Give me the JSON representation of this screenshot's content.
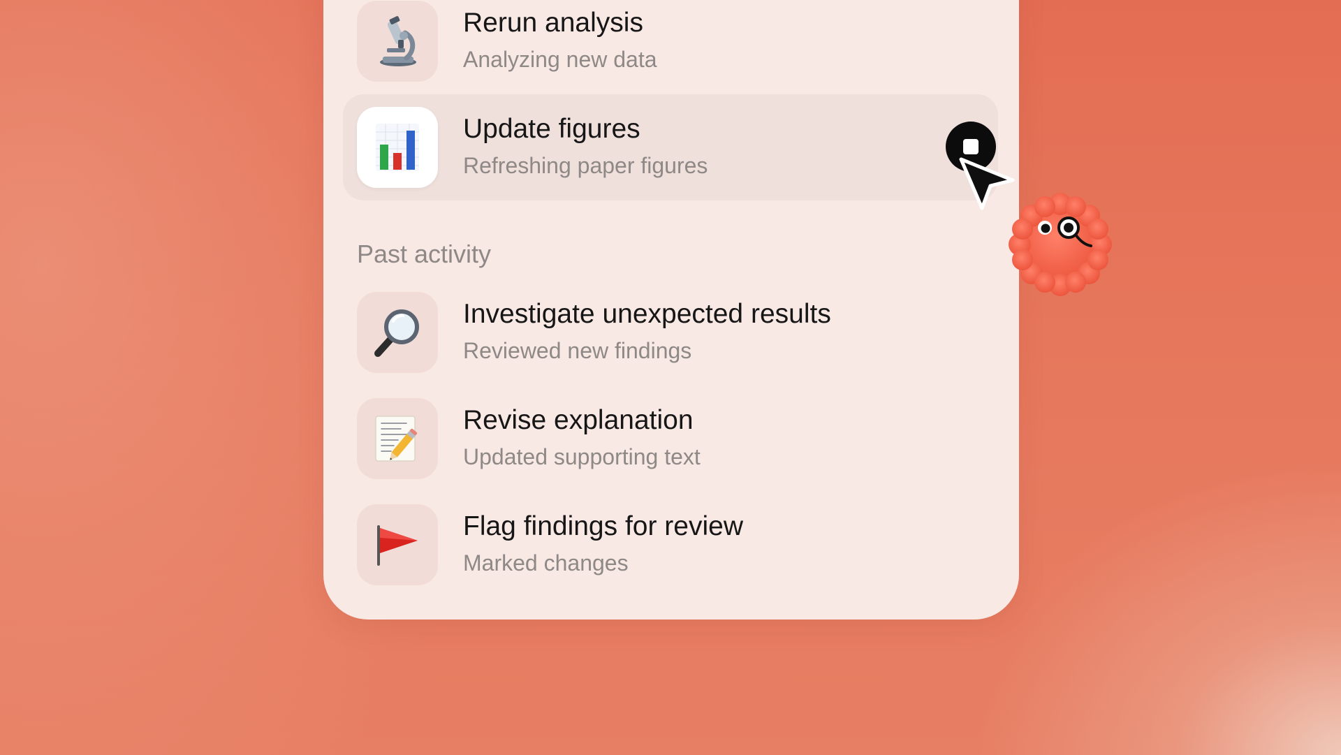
{
  "current_tasks": [
    {
      "title": "Rerun analysis",
      "subtitle": "Analyzing new data",
      "icon": "microscope-icon"
    },
    {
      "title": "Update figures",
      "subtitle": "Refreshing paper figures",
      "icon": "bar-chart-icon",
      "active": true
    }
  ],
  "past_activity": {
    "label": "Past activity",
    "items": [
      {
        "title": "Investigate unexpected results",
        "subtitle": "Reviewed new findings",
        "icon": "magnifying-glass-icon"
      },
      {
        "title": "Revise explanation",
        "subtitle": "Updated supporting text",
        "icon": "memo-pencil-icon"
      },
      {
        "title": "Flag findings for review",
        "subtitle": "Marked changes",
        "icon": "red-flag-icon"
      }
    ]
  },
  "controls": {
    "stop_icon": "stop-icon",
    "cursor_icon": "cursor-arrow-icon"
  },
  "colors": {
    "background": "#e36d53",
    "panel": "#f9e9e5",
    "active_row": "#f0e0dc",
    "mascot": "#f2644a"
  }
}
